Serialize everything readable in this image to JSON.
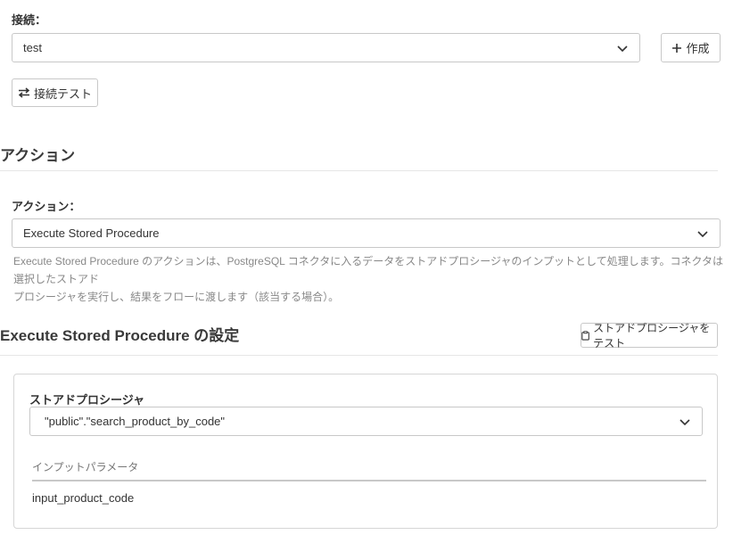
{
  "connection": {
    "label": "接続：",
    "selected": "test",
    "create_button": "作成",
    "test_button": "接続テスト"
  },
  "action_section": {
    "title": "アクション",
    "label": "アクション：",
    "selected": "Execute Stored Procedure",
    "help_line1": "Execute Stored Procedure のアクションは、PostgreSQL コネクタに入るデータをストアドプロシージャのインプットとして処理します。コネクタは選択したストアド",
    "help_line2": "プロシージャを実行し、結果をフローに渡します（該当する場合）。"
  },
  "settings_section": {
    "title": "Execute Stored Procedure の設定",
    "test_button": "ストアドプロシージャをテスト",
    "procedure_label": "ストアドプロシージャ",
    "procedure_selected": "\"public\".\"search_product_by_code\"",
    "input_params_header": "インプットパラメータ",
    "input_params": [
      "input_product_code"
    ]
  },
  "icons": {
    "chevron": "chevron-down-icon",
    "plus": "plus-icon",
    "exchange": "exchange-icon",
    "clipboard": "clipboard-icon"
  }
}
